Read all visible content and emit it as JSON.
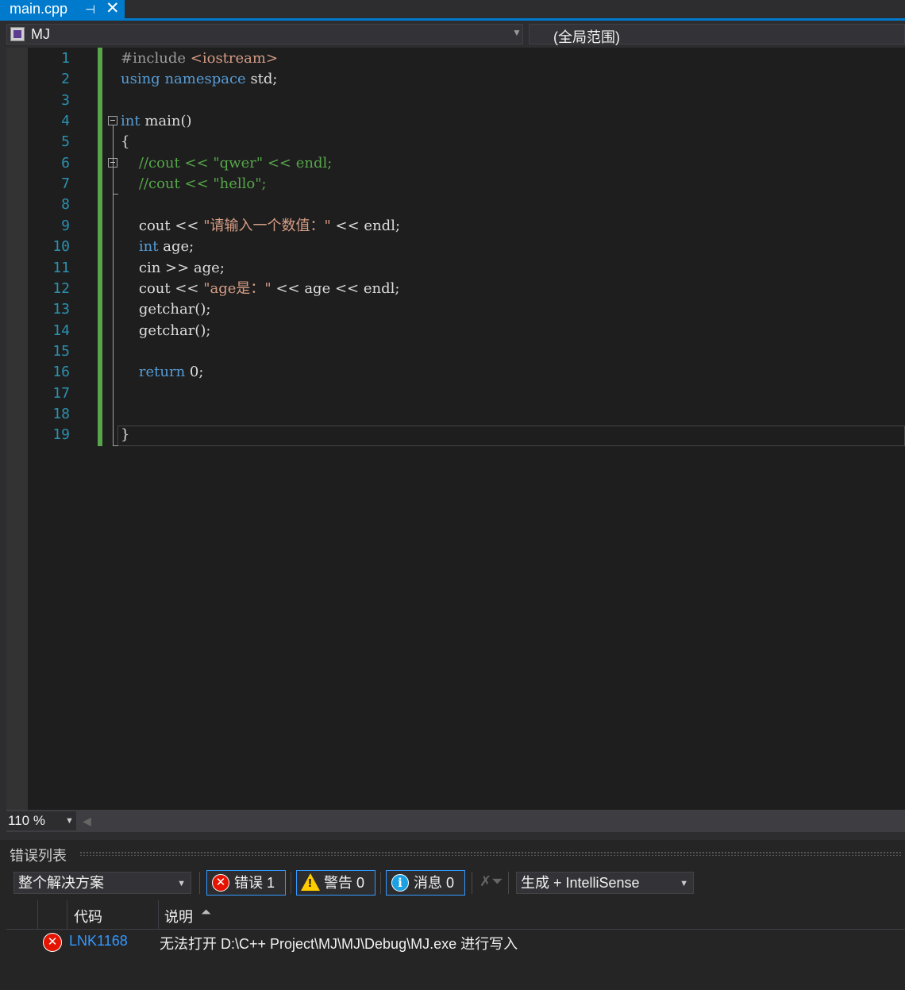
{
  "tab": {
    "title": "main.cpp",
    "pin_glyph": "⊣",
    "close_glyph": "✕"
  },
  "nav": {
    "project": "MJ",
    "scope": "(全局范围)"
  },
  "editor": {
    "line_numbers": [
      "1",
      "2",
      "3",
      "4",
      "5",
      "6",
      "7",
      "8",
      "9",
      "10",
      "11",
      "12",
      "13",
      "14",
      "15",
      "16",
      "17",
      "18",
      "19"
    ],
    "lines": [
      [
        {
          "t": "#include ",
          "c": "pp"
        },
        {
          "t": "<iostream>",
          "c": "str"
        }
      ],
      [
        {
          "t": "using",
          "c": "kw"
        },
        {
          "t": " "
        },
        {
          "t": "namespace",
          "c": "kw"
        },
        {
          "t": " std;"
        }
      ],
      [],
      [
        {
          "t": "int",
          "c": "kw"
        },
        {
          "t": " main()"
        }
      ],
      [
        {
          "t": "{"
        }
      ],
      [
        {
          "t": "    //cout << \"qwer\" << endl;",
          "c": "cm"
        }
      ],
      [
        {
          "t": "    //cout << \"hello\";",
          "c": "cm"
        }
      ],
      [],
      [
        {
          "t": "    cout << "
        },
        {
          "t": "\"请输入一个数值：\"",
          "c": "str"
        },
        {
          "t": " << endl;"
        }
      ],
      [
        {
          "t": "    "
        },
        {
          "t": "int",
          "c": "kw"
        },
        {
          "t": " age;"
        }
      ],
      [
        {
          "t": "    cin >> age;"
        }
      ],
      [
        {
          "t": "    cout << "
        },
        {
          "t": "\"age是：\"",
          "c": "str"
        },
        {
          "t": " << age << endl;"
        }
      ],
      [
        {
          "t": "    getchar();"
        }
      ],
      [
        {
          "t": "    getchar();"
        }
      ],
      [],
      [
        {
          "t": "    "
        },
        {
          "t": "return",
          "c": "kw"
        },
        {
          "t": " 0;"
        }
      ],
      [],
      [],
      [
        {
          "t": "}"
        }
      ]
    ]
  },
  "zoom": {
    "value": "110 %"
  },
  "error_list": {
    "title": "错误列表",
    "scope_select": "整个解决方案",
    "errors_button": "错误 1",
    "warnings_button": "警告 0",
    "messages_button": "消息 0",
    "build_filter": "生成 + IntelliSense",
    "columns": {
      "code": "代码",
      "description": "说明"
    },
    "rows": [
      {
        "code": "LNK1168",
        "description": "无法打开 D:\\C++ Project\\MJ\\MJ\\Debug\\MJ.exe 进行写入"
      }
    ]
  },
  "colors": {
    "accent": "#007acc",
    "keyword": "#569cd6",
    "string": "#d69d85",
    "comment": "#57a64a",
    "line_number": "#2b91af",
    "error": "#e51400"
  }
}
